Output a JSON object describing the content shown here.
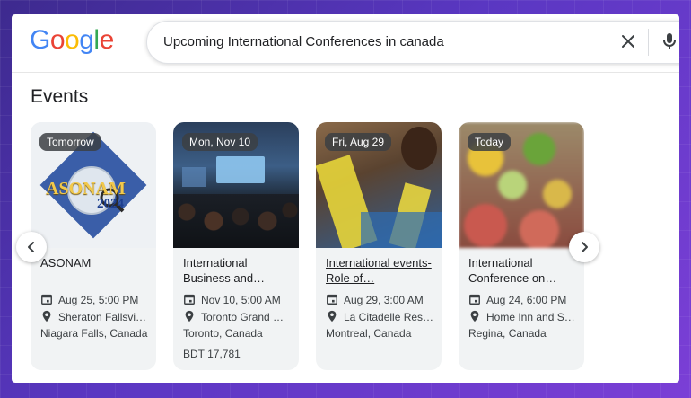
{
  "search": {
    "query": "Upcoming International Conferences in canada"
  },
  "logo": {
    "letters": [
      "G",
      "o",
      "o",
      "g",
      "l",
      "e"
    ],
    "colors": [
      "#4285F4",
      "#EA4335",
      "#FBBC05",
      "#4285F4",
      "#34A853",
      "#EA4335"
    ]
  },
  "events": {
    "title": "Events",
    "cards": [
      {
        "badge": "Tomorrow",
        "title": "ASONAM",
        "date": "Aug 25, 5:00 PM",
        "venue": "Sheraton Fallsvi…",
        "city": "Niagara Falls, Canada",
        "price": "",
        "image_logo_text": "ASONAM",
        "image_logo_year": "2024"
      },
      {
        "badge": "Mon, Nov 10",
        "title": "International Business and…",
        "date": "Nov 10, 5:00 AM",
        "venue": "Toronto Grand …",
        "city": "Toronto, Canada",
        "price": "BDT 17,781"
      },
      {
        "badge": "Fri, Aug 29",
        "title": "International events- Role of…",
        "date": "Aug 29, 3:00 AM",
        "venue": "La Citadelle Res…",
        "city": "Montreal, Canada",
        "price": ""
      },
      {
        "badge": "Today",
        "title": "International Conference on…",
        "date": "Aug 24, 6:00 PM",
        "venue": "Home Inn and S…",
        "city": "Regina, Canada",
        "price": ""
      }
    ]
  },
  "icons": {
    "clear": "close-icon",
    "mic": "microphone-icon",
    "calendar": "calendar-icon",
    "pin": "location-pin-icon",
    "prev": "chevron-left-icon",
    "next": "chevron-right-icon"
  }
}
